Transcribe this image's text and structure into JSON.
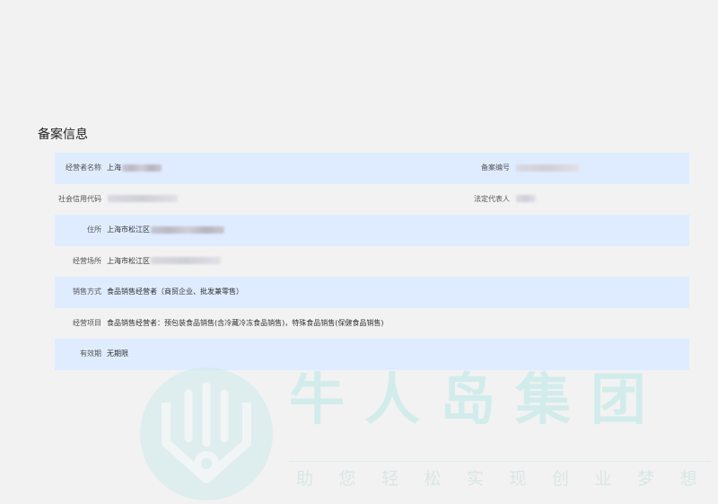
{
  "section_title": "备案信息",
  "rows": [
    {
      "label": "经营者名称",
      "value": "上海",
      "label2": "备案编号",
      "value2": ""
    },
    {
      "label": "社会信用代码",
      "value": "",
      "label2": "法定代表人",
      "value2": ""
    },
    {
      "label": "住所",
      "value": "上海市松江区"
    },
    {
      "label": "经营场所",
      "value": "上海市松江区"
    },
    {
      "label": "销售方式",
      "value": "食品销售经营者（商贸企业、批发兼零售）"
    },
    {
      "label": "经营项目",
      "value": "食品销售经营者：预包装食品销售(含冷藏冷冻食品销售)，特殊食品销售(保健食品销售)"
    },
    {
      "label": "有效期",
      "value": "无期限"
    }
  ],
  "watermark": {
    "brand": "牛人岛集团",
    "slogan": "助您轻松实现创业梦想"
  },
  "colors": {
    "row_shade": "#dfecff",
    "background": "#f2f2f2",
    "watermark": "#d2ecec"
  }
}
